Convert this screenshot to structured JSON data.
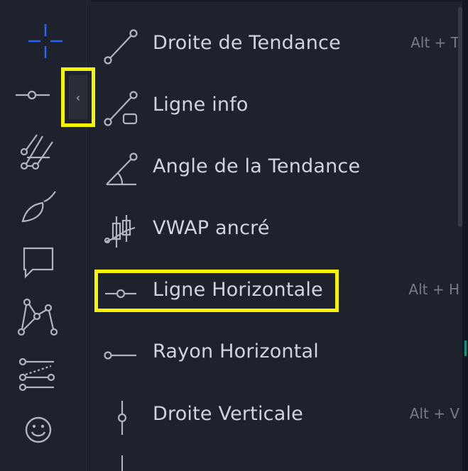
{
  "toolbar": {
    "tools": [
      {
        "icon": "crosshair-icon"
      },
      {
        "icon": "line-tool-icon"
      },
      {
        "icon": "fib-tools-icon"
      },
      {
        "icon": "brush-icon"
      },
      {
        "icon": "comment-icon"
      },
      {
        "icon": "patterns-icon"
      },
      {
        "icon": "prediction-tools-icon"
      },
      {
        "icon": "smiley-icon"
      }
    ],
    "collapse_glyph": "‹"
  },
  "menu": {
    "items": [
      {
        "label": "Droite de Tendance",
        "shortcut": "Alt + T",
        "icon": "trend-line-icon"
      },
      {
        "label": "Ligne info",
        "shortcut": "",
        "icon": "info-line-icon"
      },
      {
        "label": "Angle de la Tendance",
        "shortcut": "",
        "icon": "trend-angle-icon"
      },
      {
        "label": "VWAP ancré",
        "shortcut": "",
        "icon": "anchored-vwap-icon"
      },
      {
        "label": "Ligne Horizontale",
        "shortcut": "Alt + H",
        "icon": "horizontal-line-icon"
      },
      {
        "label": "Rayon Horizontal",
        "shortcut": "",
        "icon": "horizontal-ray-icon"
      },
      {
        "label": "Droite Verticale",
        "shortcut": "Alt + V",
        "icon": "vertical-line-icon"
      }
    ]
  },
  "colors": {
    "highlight": "#f5f500",
    "accent": "#2962ff",
    "text": "#d1d4dc",
    "muted": "#787b86",
    "panel": "#1e222d"
  }
}
